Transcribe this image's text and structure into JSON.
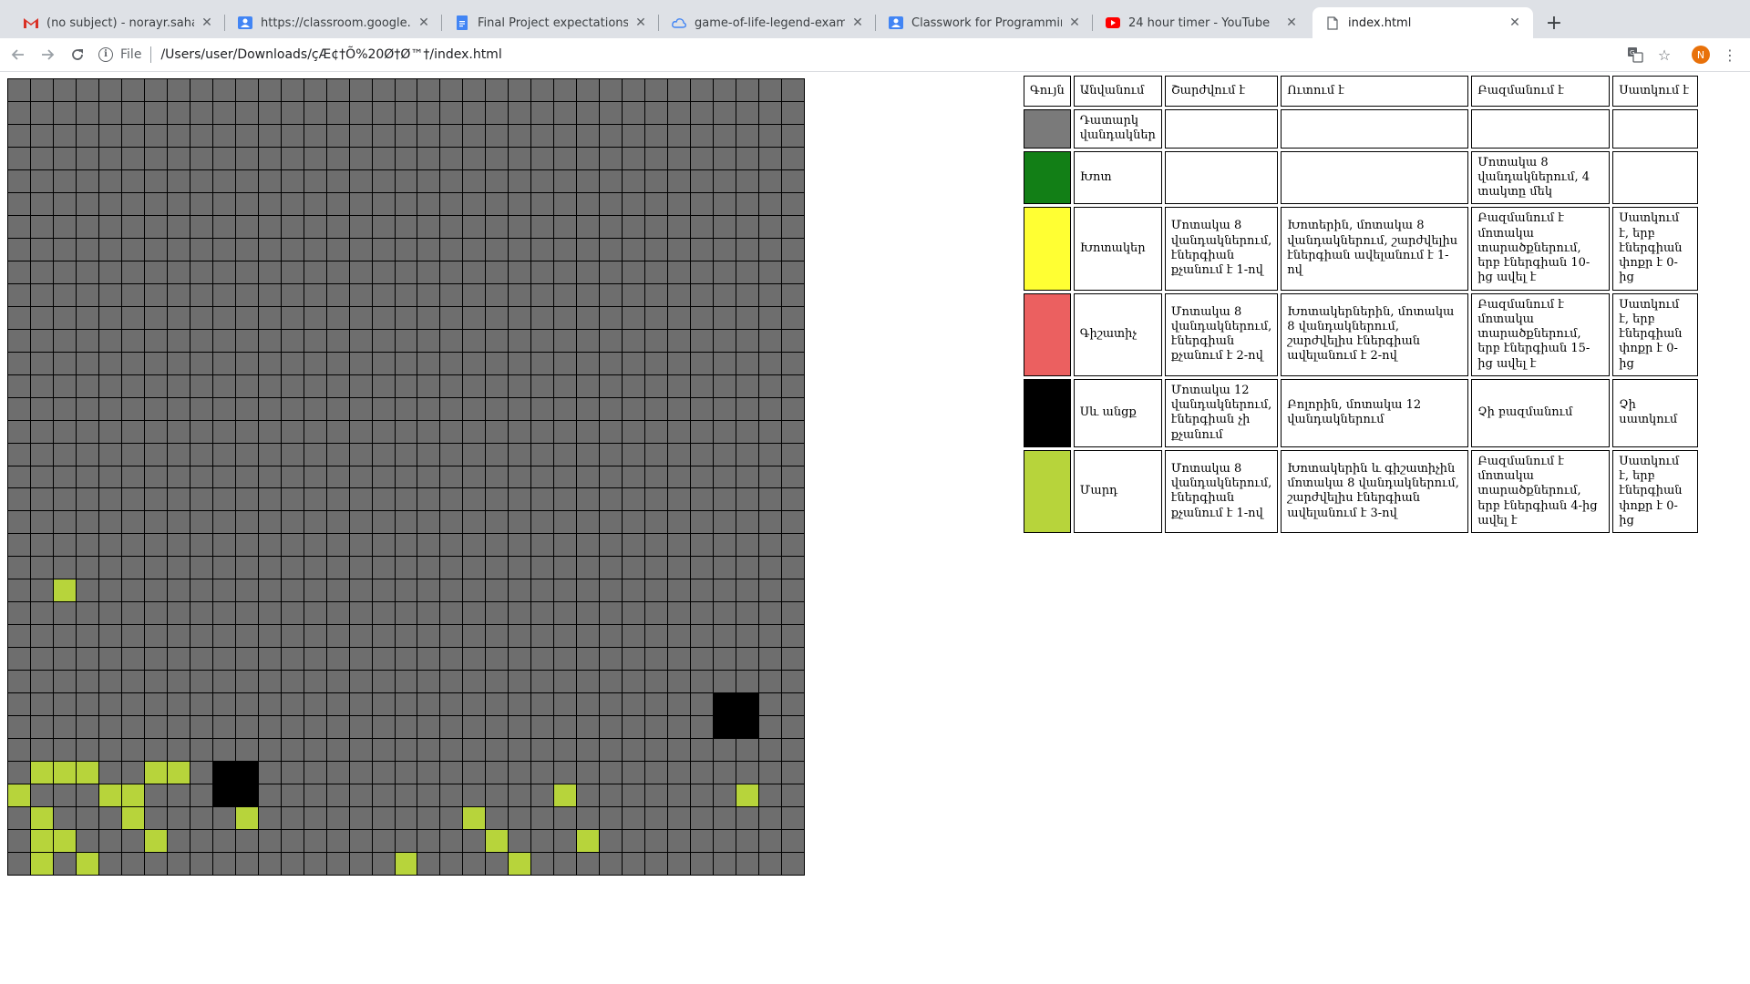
{
  "browser": {
    "tabs": [
      {
        "title": "(no subject) - norayr.sahakyan",
        "icon": "gmail-icon",
        "active": false
      },
      {
        "title": "https://classroom.google.com/",
        "icon": "classroom-icon",
        "active": false
      },
      {
        "title": "Final Project expectations/Աշ",
        "icon": "docs-icon",
        "active": false
      },
      {
        "title": "game-of-life-legend-example",
        "icon": "cloud-icon",
        "active": false
      },
      {
        "title": "Classwork for Programming || A",
        "icon": "classroom-icon",
        "active": false
      },
      {
        "title": "24 hour timer - YouTube",
        "icon": "youtube-icon",
        "active": false
      },
      {
        "title": "index.html",
        "icon": "file-icon",
        "active": true
      }
    ],
    "address": {
      "scheme": "File",
      "url": "/Users/user/Downloads/çÆ¢†Õ%20Ø†Ø™†/index.html"
    },
    "profile_initial": "N",
    "colors": {
      "tabstrip": "#dee1e6",
      "profile": "#e8710a"
    }
  },
  "grid": {
    "rows": 35,
    "cols": 35,
    "colors": {
      "empty": "#6e6e6e",
      "person": "#b7d43b",
      "black_hole": "#000000",
      "gridline": "#000000"
    },
    "person_cells": [
      [
        22,
        2
      ],
      [
        30,
        1
      ],
      [
        30,
        2
      ],
      [
        30,
        3
      ],
      [
        30,
        6
      ],
      [
        30,
        7
      ],
      [
        31,
        0
      ],
      [
        31,
        4
      ],
      [
        31,
        5
      ],
      [
        31,
        24
      ],
      [
        31,
        32
      ],
      [
        32,
        1
      ],
      [
        32,
        5
      ],
      [
        32,
        10
      ],
      [
        32,
        20
      ],
      [
        33,
        1
      ],
      [
        33,
        2
      ],
      [
        33,
        6
      ],
      [
        33,
        21
      ],
      [
        33,
        25
      ],
      [
        34,
        1
      ],
      [
        34,
        3
      ],
      [
        34,
        17
      ],
      [
        34,
        22
      ]
    ],
    "black_cells": [
      [
        27,
        31
      ],
      [
        27,
        32
      ],
      [
        28,
        31
      ],
      [
        28,
        32
      ],
      [
        30,
        9
      ],
      [
        30,
        10
      ],
      [
        31,
        9
      ],
      [
        31,
        10
      ]
    ]
  },
  "legend": {
    "headers": [
      "Գույն",
      "Անվանում",
      "Շարժվում է",
      "Ուտում է",
      "Բազմանում է",
      "Սատկում է"
    ],
    "rows": [
      {
        "color": "#7a7a7a",
        "name": "Դատարկ վանդակներ",
        "moves": "",
        "eats": "",
        "multiplies": "",
        "dies": ""
      },
      {
        "color": "#127f16",
        "name": "Խոտ",
        "moves": "",
        "eats": "",
        "multiplies": "Մոտակա 8 վանդակներում, 4 տակտը մեկ",
        "dies": ""
      },
      {
        "color": "#ffff33",
        "name": "Խոտակեր",
        "moves": "Մոտակա 8 վանդակներում, էներգիան քչանում է 1-ով",
        "eats": "Խոտերին, մոտակա 8 վանդակներում, շարժվելիս էներգիան ավելանում է 1-ով",
        "multiplies": "Բազմանում է մոտակա տարածքներում, երբ էներգիան 10-ից ավել է",
        "dies": "Սատկում է, երբ էներգիան փոքր է 0-ից"
      },
      {
        "color": "#eb6060",
        "name": "Գիշատիչ",
        "moves": "Մոտակա 8 վանդակներում, էներգիան քչանում է 2-ով",
        "eats": "Խոտակերներին, մոտակա 8 վանդակներում, շարժվելիս էներգիան ավելանում է 2-ով",
        "multiplies": "Բազմանում է մոտակա տարածքներում, երբ էներգիան 15-ից ավել է",
        "dies": "Սատկում է, երբ էներգիան փոքր է 0-ից"
      },
      {
        "color": "#000000",
        "name": "Սև անցք",
        "moves": "Մոտակա 12 վանդակներում, էներգիան չի քչանում",
        "eats": "Բոլորին, մոտակա 12 վանդակներում",
        "multiplies": "Չի բազմանում",
        "dies": "Չի սատկում"
      },
      {
        "color": "#b7d43b",
        "name": "Մարդ",
        "moves": "Մոտակա 8 վանդակներում, էներգիան քչանում է 1-ով",
        "eats": "Խոտակերին և գիշատիչին մոտակա 8 վանդակներում, շարժվելիս էներգիան ավելանում է 3-ով",
        "multiplies": "Բազմանում է մոտակա տարածքներում, երբ էներգիան 4-ից ավել է",
        "dies": "Սատկում է, երբ էներգիան փոքր է 0-ից"
      }
    ]
  }
}
